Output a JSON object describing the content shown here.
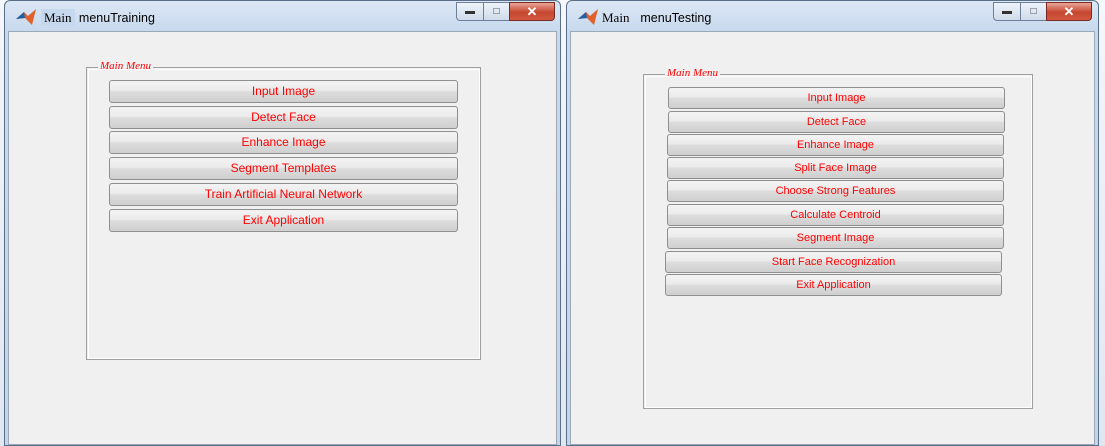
{
  "colors": {
    "button_text": "#ff0000",
    "legend_text": "#ff0000",
    "close_button": "#c6462f",
    "client_bg": "#f0f0f0"
  },
  "icons": {
    "app_icon": "matlab-logo-icon",
    "minimize": "minimize-icon",
    "maximize": "maximize-icon",
    "close": "close-icon"
  },
  "training_window": {
    "title_highlight": "Main",
    "title_rest": " menuTraining",
    "panel_title": "Main  Menu",
    "buttons": [
      "Input Image",
      "Detect Face",
      "Enhance Image",
      "Segment Templates",
      "Train Artificial Neural Network",
      "Exit Application"
    ]
  },
  "testing_window": {
    "title_highlight": "Main",
    "title_rest": "  menuTesting",
    "panel_title": "Main  Menu",
    "buttons": [
      "Input Image",
      "Detect Face",
      "Enhance Image",
      "Split Face Image",
      "Choose Strong Features",
      "Calculate Centroid",
      "Segment Image",
      "Start Face Recognization",
      "Exit Application"
    ]
  }
}
